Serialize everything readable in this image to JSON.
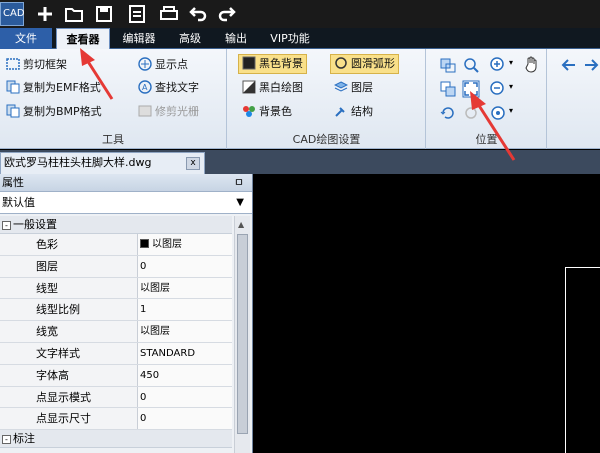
{
  "app": {
    "logo_text": "CAD"
  },
  "menu": {
    "tabs": [
      {
        "label": "文件"
      },
      {
        "label": "查看器"
      },
      {
        "label": "编辑器"
      },
      {
        "label": "高级"
      },
      {
        "label": "输出"
      },
      {
        "label": "VIP功能"
      }
    ]
  },
  "ribbon": {
    "tools": {
      "label": "工具",
      "items": [
        "剪切框架",
        "复制为EMF格式",
        "复制为BMP格式",
        "显示点",
        "查找文字",
        "修剪光栅"
      ]
    },
    "cad_settings": {
      "label": "CAD绘图设置",
      "items": [
        "黑色背景",
        "圆滑弧形",
        "黑白绘图",
        "图层",
        "背景色",
        "结构"
      ]
    },
    "position": {
      "label": "位置"
    }
  },
  "document": {
    "tab_title": "欧式罗马柱柱头柱脚大样.dwg",
    "close_glyph": "x"
  },
  "properties": {
    "title": "属性",
    "pin_glyph": "ㅁ",
    "selector_value": "默认值",
    "categories": [
      {
        "label": "一般设置",
        "toggle": "-",
        "rows": [
          {
            "name": "色彩",
            "value": "以图层"
          },
          {
            "name": "图层",
            "value": "0"
          },
          {
            "name": "线型",
            "value": "以图层"
          },
          {
            "name": "线型比例",
            "value": "1"
          },
          {
            "name": "线宽",
            "value": "以图层"
          },
          {
            "name": "文字样式",
            "value": "STANDARD"
          },
          {
            "name": "字体高",
            "value": "450"
          },
          {
            "name": "点显示模式",
            "value": "0"
          },
          {
            "name": "点显示尺寸",
            "value": "0"
          }
        ]
      },
      {
        "label": "标注",
        "toggle": "-"
      }
    ]
  },
  "colors": {
    "accent_red": "#e53935",
    "file_tab": "#2d5fa8",
    "checked_bg": "#f9e08a"
  }
}
